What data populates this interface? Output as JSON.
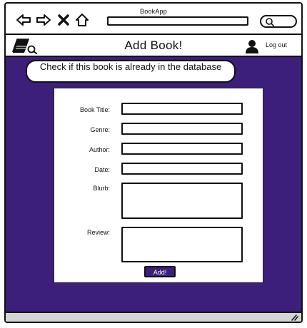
{
  "browser": {
    "title": "BookApp",
    "nav_icons": [
      "back-arrow-icon",
      "forward-arrow-icon",
      "close-icon",
      "home-icon"
    ],
    "address": "",
    "search_icon": "search-icon"
  },
  "header": {
    "logo_icon": "book-search-logo",
    "title": "Add Book!",
    "user_icon": "user-icon",
    "logout_label": "Log out"
  },
  "callout": {
    "text": "Check if this book is already in the database"
  },
  "form": {
    "fields": [
      {
        "label": "Book Title:",
        "value": ""
      },
      {
        "label": "Genre:",
        "value": ""
      },
      {
        "label": "Author:",
        "value": ""
      },
      {
        "label": "Date:",
        "value": ""
      },
      {
        "label": "Blurb:",
        "value": ""
      },
      {
        "label": "Review:",
        "value": ""
      }
    ],
    "submit_label": "Add!"
  },
  "colors": {
    "primary_purple": "#3b1f7a",
    "footer_gray": "#d4d4d4"
  }
}
